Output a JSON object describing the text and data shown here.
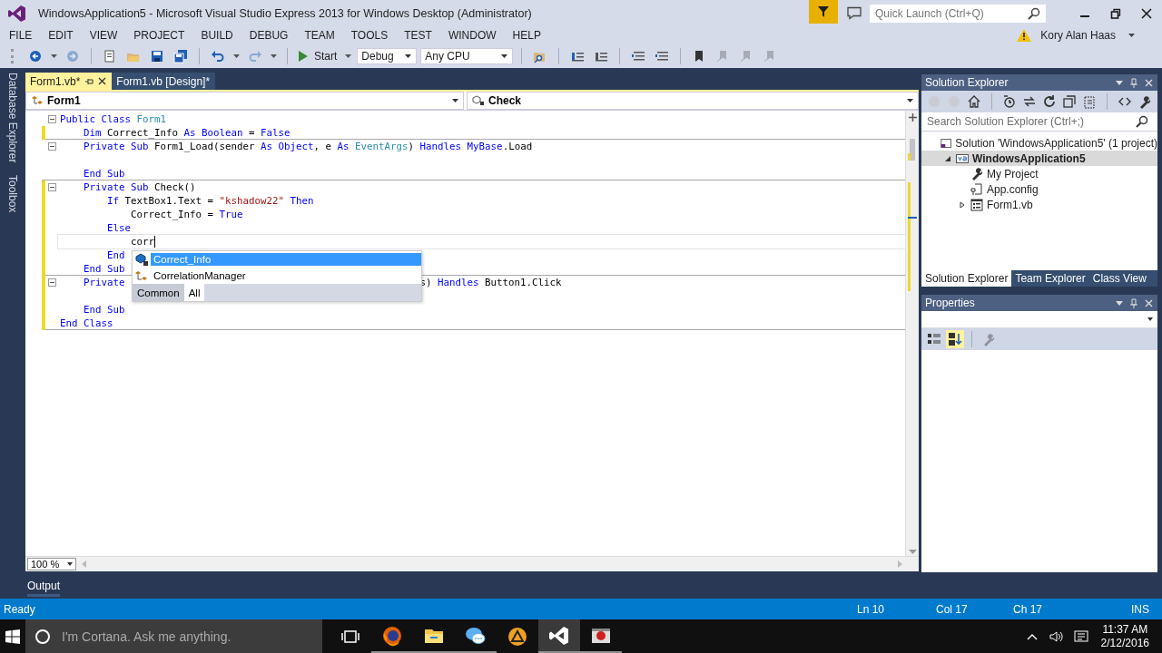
{
  "window": {
    "title": "WindowsApplication5 - Microsoft Visual Studio Express 2013 for Windows Desktop (Administrator)",
    "quick_launch_placeholder": "Quick Launch (Ctrl+Q)",
    "user": "Kory Alan Haas"
  },
  "menu": [
    "FILE",
    "EDIT",
    "VIEW",
    "PROJECT",
    "BUILD",
    "DEBUG",
    "TEAM",
    "TOOLS",
    "TEST",
    "WINDOW",
    "HELP"
  ],
  "toolbar": {
    "buttons": [
      {
        "kind": "back",
        "disabled": false
      },
      {
        "kind": "forward",
        "disabled": true
      },
      {
        "kind": "new-project",
        "disabled": false
      },
      {
        "kind": "open",
        "disabled": false
      },
      {
        "kind": "save",
        "disabled": false
      },
      {
        "kind": "save-all",
        "disabled": false
      },
      {
        "kind": "undo",
        "disabled": false
      },
      {
        "kind": "redo",
        "disabled": true
      }
    ],
    "start_label": "Start",
    "configuration": "Debug",
    "platform": "Any CPU",
    "buttons_after": [
      {
        "kind": "find",
        "disabled": false
      },
      {
        "kind": "indent",
        "disabled": false
      },
      {
        "kind": "outdent",
        "disabled": false
      },
      {
        "kind": "comment",
        "disabled": false
      },
      {
        "kind": "uncomment",
        "disabled": false
      },
      {
        "kind": "bookmark",
        "disabled": false
      },
      {
        "kind": "bookmark-prev",
        "disabled": true
      },
      {
        "kind": "bookmark-next",
        "disabled": true
      },
      {
        "kind": "bookmark-clear",
        "disabled": true
      }
    ]
  },
  "side_tabs": [
    "Database Explorer",
    "Toolbox"
  ],
  "doc_tabs": [
    {
      "label": "Form1.vb*",
      "selected": true
    },
    {
      "label": "Form1.vb [Design]*",
      "selected": false
    }
  ],
  "nav_bar": {
    "type": "Form1",
    "member": "Check"
  },
  "code": {
    "lines": [
      {
        "tokens": [
          {
            "text": "Public Class ",
            "kind": "kw"
          },
          {
            "text": "Form1",
            "kind": "type"
          }
        ],
        "collapsible": true,
        "changed": false,
        "divider_below": false,
        "current": false
      },
      {
        "tokens": [
          {
            "text": "    Dim ",
            "kind": "kw"
          },
          {
            "text": "Correct_Info ",
            "kind": "plain"
          },
          {
            "text": "As Boolean",
            "kind": "kw"
          },
          {
            "text": " = ",
            "kind": "plain"
          },
          {
            "text": "False",
            "kind": "kw"
          }
        ],
        "collapsible": false,
        "changed": true,
        "divider_below": true,
        "current": false
      },
      {
        "tokens": [
          {
            "text": "    Private Sub ",
            "kind": "kw"
          },
          {
            "text": "Form1_Load(sender ",
            "kind": "plain"
          },
          {
            "text": "As Object",
            "kind": "kw"
          },
          {
            "text": ", e ",
            "kind": "plain"
          },
          {
            "text": "As ",
            "kind": "kw"
          },
          {
            "text": "EventArgs",
            "kind": "type"
          },
          {
            "text": ") ",
            "kind": "plain"
          },
          {
            "text": "Handles MyBase",
            "kind": "kw"
          },
          {
            "text": ".Load",
            "kind": "plain"
          }
        ],
        "collapsible": true,
        "changed": false,
        "divider_below": false,
        "current": false
      },
      {
        "collapsible": false,
        "changed": false,
        "divider_below": false,
        "current": false
      },
      {
        "tokens": [
          {
            "text": "    End Sub",
            "kind": "kw"
          }
        ],
        "collapsible": false,
        "changed": false,
        "divider_below": true,
        "current": false
      },
      {
        "tokens": [
          {
            "text": "    Private Sub ",
            "kind": "kw"
          },
          {
            "text": "Check()",
            "kind": "plain"
          }
        ],
        "collapsible": true,
        "changed": true,
        "divider_below": false,
        "current": false
      },
      {
        "tokens": [
          {
            "text": "        If ",
            "kind": "kw"
          },
          {
            "text": "TextBox1.Text = ",
            "kind": "plain"
          },
          {
            "text": "\"kshadow22\"",
            "kind": "str"
          },
          {
            "text": " Then",
            "kind": "kw"
          }
        ],
        "collapsible": false,
        "changed": true,
        "divider_below": false,
        "current": false
      },
      {
        "tokens": [
          {
            "text": "            Correct_Info = ",
            "kind": "plain"
          },
          {
            "text": "True",
            "kind": "kw"
          }
        ],
        "collapsible": false,
        "changed": true,
        "divider_below": false,
        "current": false
      },
      {
        "tokens": [
          {
            "text": "        Else",
            "kind": "kw"
          }
        ],
        "collapsible": false,
        "changed": true,
        "divider_below": false,
        "current": false
      },
      {
        "tokens": [
          {
            "text": "            corr",
            "kind": "plain"
          }
        ],
        "collapsible": false,
        "changed": true,
        "divider_below": false,
        "current": true
      },
      {
        "tokens": [
          {
            "text": "        End",
            "kind": "kw"
          }
        ],
        "collapsible": false,
        "changed": true,
        "divider_below": false,
        "current": false
      },
      {
        "tokens": [
          {
            "text": "    End Sub",
            "kind": "kw"
          }
        ],
        "collapsible": false,
        "changed": true,
        "divider_below": true,
        "current": false
      },
      {
        "tokens": [
          {
            "text": "    Private",
            "kind": "kw"
          },
          {
            "text": "                                                  s) ",
            "kind": "plain"
          },
          {
            "text": "Handles ",
            "kind": "kw"
          },
          {
            "text": "Button1.Click",
            "kind": "plain"
          }
        ],
        "collapsible": true,
        "changed": true,
        "divider_below": false,
        "current": false
      },
      {
        "collapsible": false,
        "changed": true,
        "divider_below": false,
        "current": false
      },
      {
        "tokens": [
          {
            "text": "    End Sub",
            "kind": "kw"
          }
        ],
        "collapsible": false,
        "changed": true,
        "divider_below": false,
        "current": false
      },
      {
        "tokens": [
          {
            "text": "End Class",
            "kind": "kw"
          }
        ],
        "collapsible": false,
        "changed": true,
        "divider_below": true,
        "current": false
      }
    ]
  },
  "completion": {
    "items": [
      {
        "label": "Correct_Info",
        "kind": "field",
        "selected": true
      },
      {
        "label": "CorrelationManager",
        "kind": "class",
        "selected": false
      }
    ],
    "tabs": [
      {
        "label": "Common",
        "selected": false
      },
      {
        "label": "All",
        "selected": true
      }
    ]
  },
  "zoom": "100 %",
  "bottom_tab": "Output",
  "solution_explorer": {
    "title": "Solution Explorer",
    "search_placeholder": "Search Solution Explorer (Ctrl+;)",
    "tree": [
      {
        "label": "Solution 'WindowsApplication5' (1 project)",
        "kind": "solution",
        "selected": false,
        "children": [
          {
            "label": "WindowsApplication5",
            "kind": "vb-project",
            "selected": true,
            "expanded": true,
            "children": [
              {
                "label": "My Project",
                "kind": "settings",
                "selected": false
              },
              {
                "label": "App.config",
                "kind": "config",
                "selected": false
              },
              {
                "label": "Form1.vb",
                "kind": "form",
                "selected": false,
                "expanded": false
              }
            ]
          }
        ]
      }
    ],
    "tabs": [
      {
        "label": "Solution Explorer",
        "selected": true
      },
      {
        "label": "Team Explorer",
        "selected": false
      },
      {
        "label": "Class View",
        "selected": false
      }
    ]
  },
  "properties": {
    "title": "Properties",
    "buttons": [
      {
        "kind": "categorized",
        "selected": false,
        "disabled": false
      },
      {
        "kind": "alphabetical",
        "selected": true,
        "disabled": false
      },
      {
        "kind": "property-pages",
        "selected": false,
        "disabled": true
      }
    ]
  },
  "status_bar": {
    "message": "Ready",
    "line": "Ln 10",
    "column": "Col 17",
    "char": "Ch 17",
    "mode": "INS"
  },
  "taskbar": {
    "search_placeholder": "I'm Cortana. Ask me anything.",
    "apps": [
      {
        "kind": "task-view",
        "running": false,
        "active": false
      },
      {
        "kind": "firefox",
        "running": true,
        "active": false
      },
      {
        "kind": "folder",
        "running": true,
        "active": false
      },
      {
        "kind": "chat",
        "running": true,
        "active": false
      },
      {
        "kind": "triangle",
        "running": false,
        "active": false
      },
      {
        "kind": "visual-studio",
        "running": true,
        "active": true
      },
      {
        "kind": "recorder",
        "running": true,
        "active": false
      }
    ],
    "time": "11:37 AM",
    "date": "2/12/2016"
  }
}
